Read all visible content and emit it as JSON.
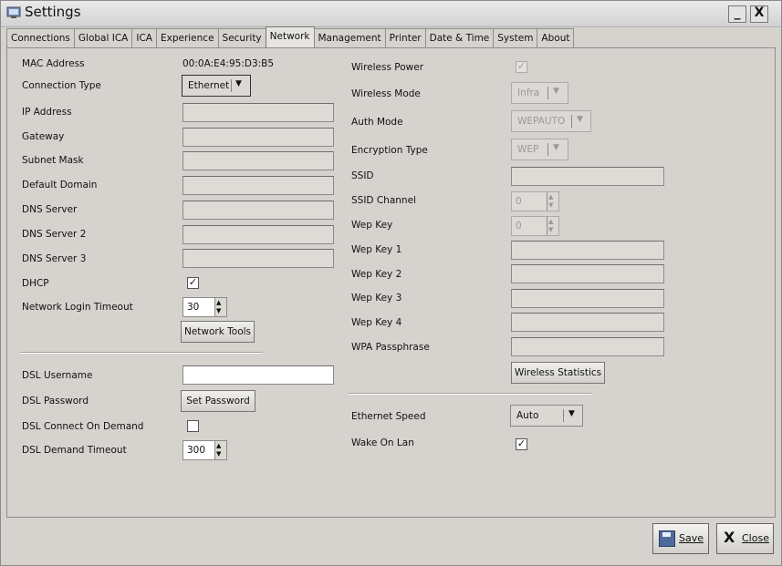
{
  "window": {
    "title": "Settings",
    "minimize_label": "_",
    "close_label": "X"
  },
  "tabs": [
    "Connections",
    "Global ICA",
    "ICA",
    "Experience",
    "Security",
    "Network",
    "Management",
    "Printer",
    "Date & Time",
    "System",
    "About"
  ],
  "active_tab": "Network",
  "left": {
    "mac_label": "MAC Address",
    "mac_value": "00:0A:E4:95:D3:B5",
    "conn_type_label": "Connection Type",
    "conn_type_value": "Ethernet",
    "ip_label": "IP Address",
    "ip_value": "",
    "gateway_label": "Gateway",
    "gateway_value": "",
    "subnet_label": "Subnet Mask",
    "subnet_value": "",
    "domain_label": "Default Domain",
    "domain_value": "",
    "dns_label": "DNS Server",
    "dns_value": "",
    "dns2_label": "DNS Server 2",
    "dns2_value": "",
    "dns3_label": "DNS Server 3",
    "dns3_value": "",
    "dhcp_label": "DHCP",
    "dhcp_checked": true,
    "timeout_label": "Network Login Timeout",
    "timeout_value": "30",
    "network_tools_label": "Network Tools",
    "dsl_user_label": "DSL Username",
    "dsl_user_value": "",
    "dsl_pass_label": "DSL Password",
    "set_password_label": "Set Password",
    "dsl_demand_label": "DSL Connect On Demand",
    "dsl_demand_checked": false,
    "dsl_timeout_label": "DSL Demand Timeout",
    "dsl_timeout_value": "300"
  },
  "right": {
    "wpower_label": "Wireless Power",
    "wpower_checked": true,
    "wmode_label": "Wireless Mode",
    "wmode_value": "Infra",
    "auth_label": "Auth Mode",
    "auth_value": "WEPAUTO",
    "enc_label": "Encryption Type",
    "enc_value": "WEP",
    "ssid_label": "SSID",
    "ssid_value": "",
    "channel_label": "SSID Channel",
    "channel_value": "0",
    "wepkey_label": "Wep Key",
    "wepkey_value": "0",
    "wepkey1_label": "Wep Key 1",
    "wepkey1_value": "",
    "wepkey2_label": "Wep Key 2",
    "wepkey2_value": "",
    "wepkey3_label": "Wep Key 3",
    "wepkey3_value": "",
    "wepkey4_label": "Wep Key 4",
    "wepkey4_value": "",
    "wpa_label": "WPA Passphrase",
    "wpa_value": "",
    "wstats_label": "Wireless Statistics",
    "eth_speed_label": "Ethernet Speed",
    "eth_speed_value": "Auto",
    "wol_label": "Wake On Lan",
    "wol_checked": true
  },
  "footer": {
    "save_label": "Save",
    "close_label": "Close"
  },
  "glyphs": {
    "check": "✓",
    "arrow": "▼",
    "up": "▲",
    "down": "▼"
  }
}
